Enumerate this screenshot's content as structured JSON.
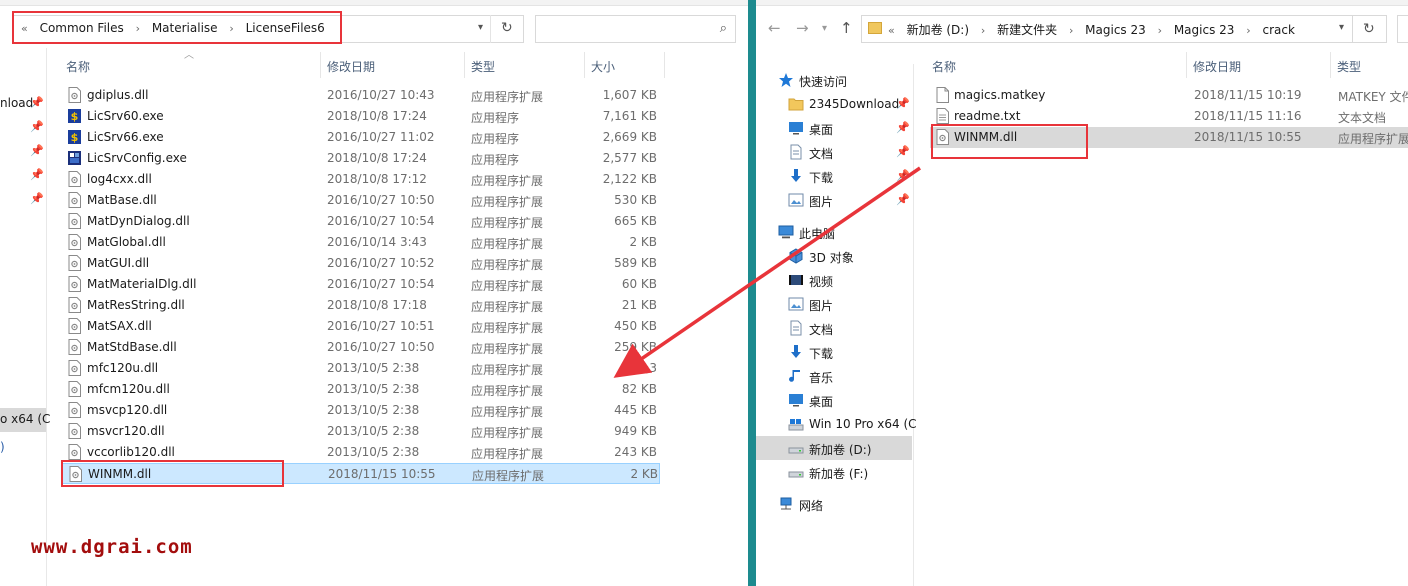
{
  "left": {
    "breadcrumb": [
      "Common Files",
      "Materialise",
      "LicenseFiles6"
    ],
    "breadcrumb_prefix": "«",
    "sidebar_fragments": [
      {
        "label": "nload"
      },
      {
        "label": "o x64 (C"
      },
      {
        "label": ")"
      }
    ],
    "columns": {
      "name": "名称",
      "date": "修改日期",
      "type": "类型",
      "size": "大小"
    },
    "files": [
      {
        "name": "gdiplus.dll",
        "date": "2016/10/27 10:43",
        "type": "应用程序扩展",
        "size": "1,607 KB",
        "icon": "dll-icon"
      },
      {
        "name": "LicSrv60.exe",
        "date": "2018/10/8 17:24",
        "type": "应用程序",
        "size": "7,161 KB",
        "icon": "license-app-icon"
      },
      {
        "name": "LicSrv66.exe",
        "date": "2016/10/27 11:02",
        "type": "应用程序",
        "size": "2,669 KB",
        "icon": "license-app-icon"
      },
      {
        "name": "LicSrvConfig.exe",
        "date": "2018/10/8 17:24",
        "type": "应用程序",
        "size": "2,577 KB",
        "icon": "config-app-icon"
      },
      {
        "name": "log4cxx.dll",
        "date": "2018/10/8 17:12",
        "type": "应用程序扩展",
        "size": "2,122 KB",
        "icon": "dll-icon"
      },
      {
        "name": "MatBase.dll",
        "date": "2016/10/27 10:50",
        "type": "应用程序扩展",
        "size": "530 KB",
        "icon": "dll-icon"
      },
      {
        "name": "MatDynDialog.dll",
        "date": "2016/10/27 10:54",
        "type": "应用程序扩展",
        "size": "665 KB",
        "icon": "dll-icon"
      },
      {
        "name": "MatGlobal.dll",
        "date": "2016/10/14 3:43",
        "type": "应用程序扩展",
        "size": "2 KB",
        "icon": "dll-icon"
      },
      {
        "name": "MatGUI.dll",
        "date": "2016/10/27 10:52",
        "type": "应用程序扩展",
        "size": "589 KB",
        "icon": "dll-icon"
      },
      {
        "name": "MatMaterialDlg.dll",
        "date": "2016/10/27 10:54",
        "type": "应用程序扩展",
        "size": "60 KB",
        "icon": "dll-icon"
      },
      {
        "name": "MatResString.dll",
        "date": "2018/10/8 17:18",
        "type": "应用程序扩展",
        "size": "21 KB",
        "icon": "dll-icon"
      },
      {
        "name": "MatSAX.dll",
        "date": "2016/10/27 10:51",
        "type": "应用程序扩展",
        "size": "450 KB",
        "icon": "dll-icon"
      },
      {
        "name": "MatStdBase.dll",
        "date": "2016/10/27 10:50",
        "type": "应用程序扩展",
        "size": "259 KB",
        "icon": "dll-icon"
      },
      {
        "name": "mfc120u.dll",
        "date": "2013/10/5 2:38",
        "type": "应用程序扩展",
        "size": "4,3",
        "icon": "dll-icon"
      },
      {
        "name": "mfcm120u.dll",
        "date": "2013/10/5 2:38",
        "type": "应用程序扩展",
        "size": "82 KB",
        "icon": "dll-icon"
      },
      {
        "name": "msvcp120.dll",
        "date": "2013/10/5 2:38",
        "type": "应用程序扩展",
        "size": "445 KB",
        "icon": "dll-icon"
      },
      {
        "name": "msvcr120.dll",
        "date": "2013/10/5 2:38",
        "type": "应用程序扩展",
        "size": "949 KB",
        "icon": "dll-icon"
      },
      {
        "name": "vccorlib120.dll",
        "date": "2013/10/5 2:38",
        "type": "应用程序扩展",
        "size": "243 KB",
        "icon": "dll-icon"
      },
      {
        "name": "WINMM.dll",
        "date": "2018/11/15 10:55",
        "type": "应用程序扩展",
        "size": "2 KB",
        "icon": "dll-icon",
        "selected": true
      }
    ],
    "watermark": "www.dgrai.com"
  },
  "right": {
    "breadcrumb": [
      "新加卷 (D:)",
      "新建文件夹",
      "Magics 23",
      "Magics 23",
      "crack"
    ],
    "breadcrumb_prefix": "«",
    "columns": {
      "name": "名称",
      "date": "修改日期",
      "type": "类型"
    },
    "tree": [
      {
        "label": "快速访问",
        "icon": "star-icon",
        "level": 0
      },
      {
        "label": "2345Download",
        "icon": "folder-icon",
        "level": 1,
        "pinned": true
      },
      {
        "label": "桌面",
        "icon": "desktop-icon",
        "level": 1,
        "pinned": true
      },
      {
        "label": "文档",
        "icon": "documents-icon",
        "level": 1,
        "pinned": true
      },
      {
        "label": "下载",
        "icon": "download-icon",
        "level": 1,
        "pinned": true
      },
      {
        "label": "图片",
        "icon": "pictures-icon",
        "level": 1,
        "pinned": true
      },
      {
        "label": "此电脑",
        "icon": "computer-icon",
        "level": 0,
        "gap": true
      },
      {
        "label": "3D 对象",
        "icon": "3d-objects-icon",
        "level": 1
      },
      {
        "label": "视频",
        "icon": "videos-icon",
        "level": 1
      },
      {
        "label": "图片",
        "icon": "pictures-icon",
        "level": 1
      },
      {
        "label": "文档",
        "icon": "documents-icon",
        "level": 1
      },
      {
        "label": "下载",
        "icon": "download-icon",
        "level": 1
      },
      {
        "label": "音乐",
        "icon": "music-icon",
        "level": 1
      },
      {
        "label": "桌面",
        "icon": "desktop-icon",
        "level": 1
      },
      {
        "label": "Win 10 Pro x64 (C",
        "icon": "drive-c-icon",
        "level": 1
      },
      {
        "label": "新加卷 (D:)",
        "icon": "drive-icon",
        "level": 1,
        "selected": true
      },
      {
        "label": "新加卷 (F:)",
        "icon": "drive-icon",
        "level": 1
      },
      {
        "label": "网络",
        "icon": "network-icon",
        "level": 0,
        "gap": true
      }
    ],
    "files": [
      {
        "name": "magics.matkey",
        "date": "2018/11/15 10:19",
        "type": "MATKEY 文件",
        "icon": "file-icon"
      },
      {
        "name": "readme.txt",
        "date": "2018/11/15 11:16",
        "type": "文本文档",
        "icon": "text-file-icon"
      },
      {
        "name": "WINMM.dll",
        "date": "2018/11/15 10:55",
        "type": "应用程序扩展",
        "icon": "dll-icon",
        "selected": true
      }
    ]
  },
  "colors": {
    "highlight": "#e8343a",
    "selection": "#cce8ff",
    "divider": "#1d8b8f",
    "watermark": "#a30d0d"
  }
}
